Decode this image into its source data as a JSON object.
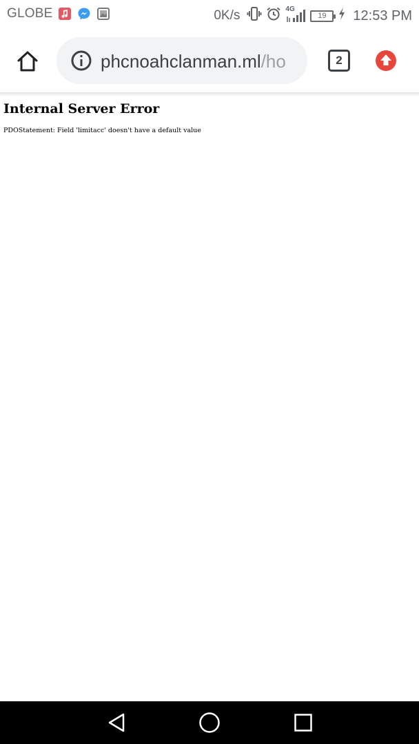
{
  "status_bar": {
    "carrier": "GLOBE",
    "notification_icons": [
      "music-icon",
      "messenger-icon",
      "gallery-icon"
    ],
    "network_speed": "0K/s",
    "network_type": "4G",
    "battery_level": "19",
    "time": "12:53 PM"
  },
  "browser": {
    "url_main": "phcnoahclanman.ml",
    "url_faded": "/ho",
    "tab_count": "2",
    "accent_color": "#e8453c"
  },
  "page": {
    "heading": "Internal Server Error",
    "message": "PDOStatement: Field 'limitacc' doesn't have a default value"
  },
  "nav_bar": {
    "buttons": [
      "back-icon",
      "home-icon",
      "recents-icon"
    ]
  }
}
